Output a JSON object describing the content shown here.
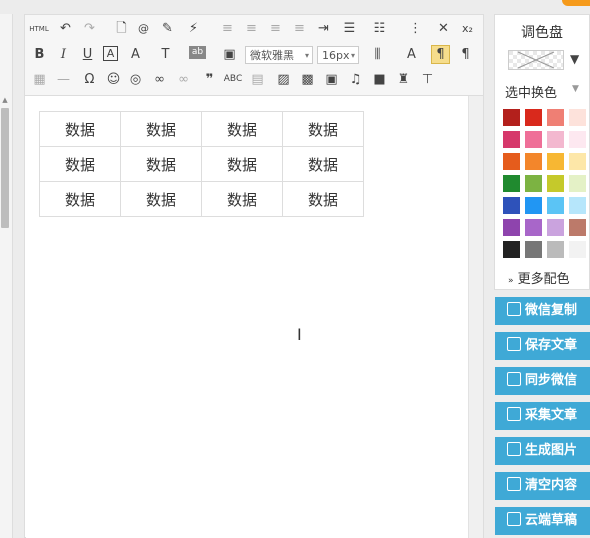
{
  "toolbar": {
    "html_label": "HTML",
    "font_family": "微软雅黑",
    "font_size": "16px"
  },
  "table": {
    "rows": [
      [
        "数据",
        "数据",
        "数据",
        "数据"
      ],
      [
        "数据",
        "数据",
        "数据",
        "数据"
      ],
      [
        "数据",
        "数据",
        "数据",
        "数据"
      ]
    ]
  },
  "palette": {
    "title": "调色盘",
    "swap_label": "选中换色",
    "more_label": "更多配色",
    "colors": [
      [
        "#b3201c",
        "#d9291c",
        "#ef7f74",
        "#fde2db"
      ],
      [
        "#d6386b",
        "#ef6f98",
        "#f3b8cf",
        "#fde8f0"
      ],
      [
        "#e55c1c",
        "#f3862b",
        "#f7b733",
        "#fde7a8"
      ],
      [
        "#208a2f",
        "#7cb342",
        "#c5c92b",
        "#e4f1c6"
      ],
      [
        "#2e52ba",
        "#2196f3",
        "#5bc4f5",
        "#b6e6fb"
      ],
      [
        "#8e44ad",
        "#a866c9",
        "#caa3de",
        "#bc7a6a"
      ],
      [
        "#222222",
        "#777777",
        "#bbbbbb",
        "#f2f2f2"
      ]
    ]
  },
  "actions": [
    {
      "label": "微信复制"
    },
    {
      "label": "保存文章"
    },
    {
      "label": "同步微信"
    },
    {
      "label": "采集文章"
    },
    {
      "label": "生成图片"
    },
    {
      "label": "清空内容"
    },
    {
      "label": "云端草稿"
    }
  ],
  "colors": {
    "accent": "#3fa9d6",
    "orange": "#f59a1b"
  }
}
